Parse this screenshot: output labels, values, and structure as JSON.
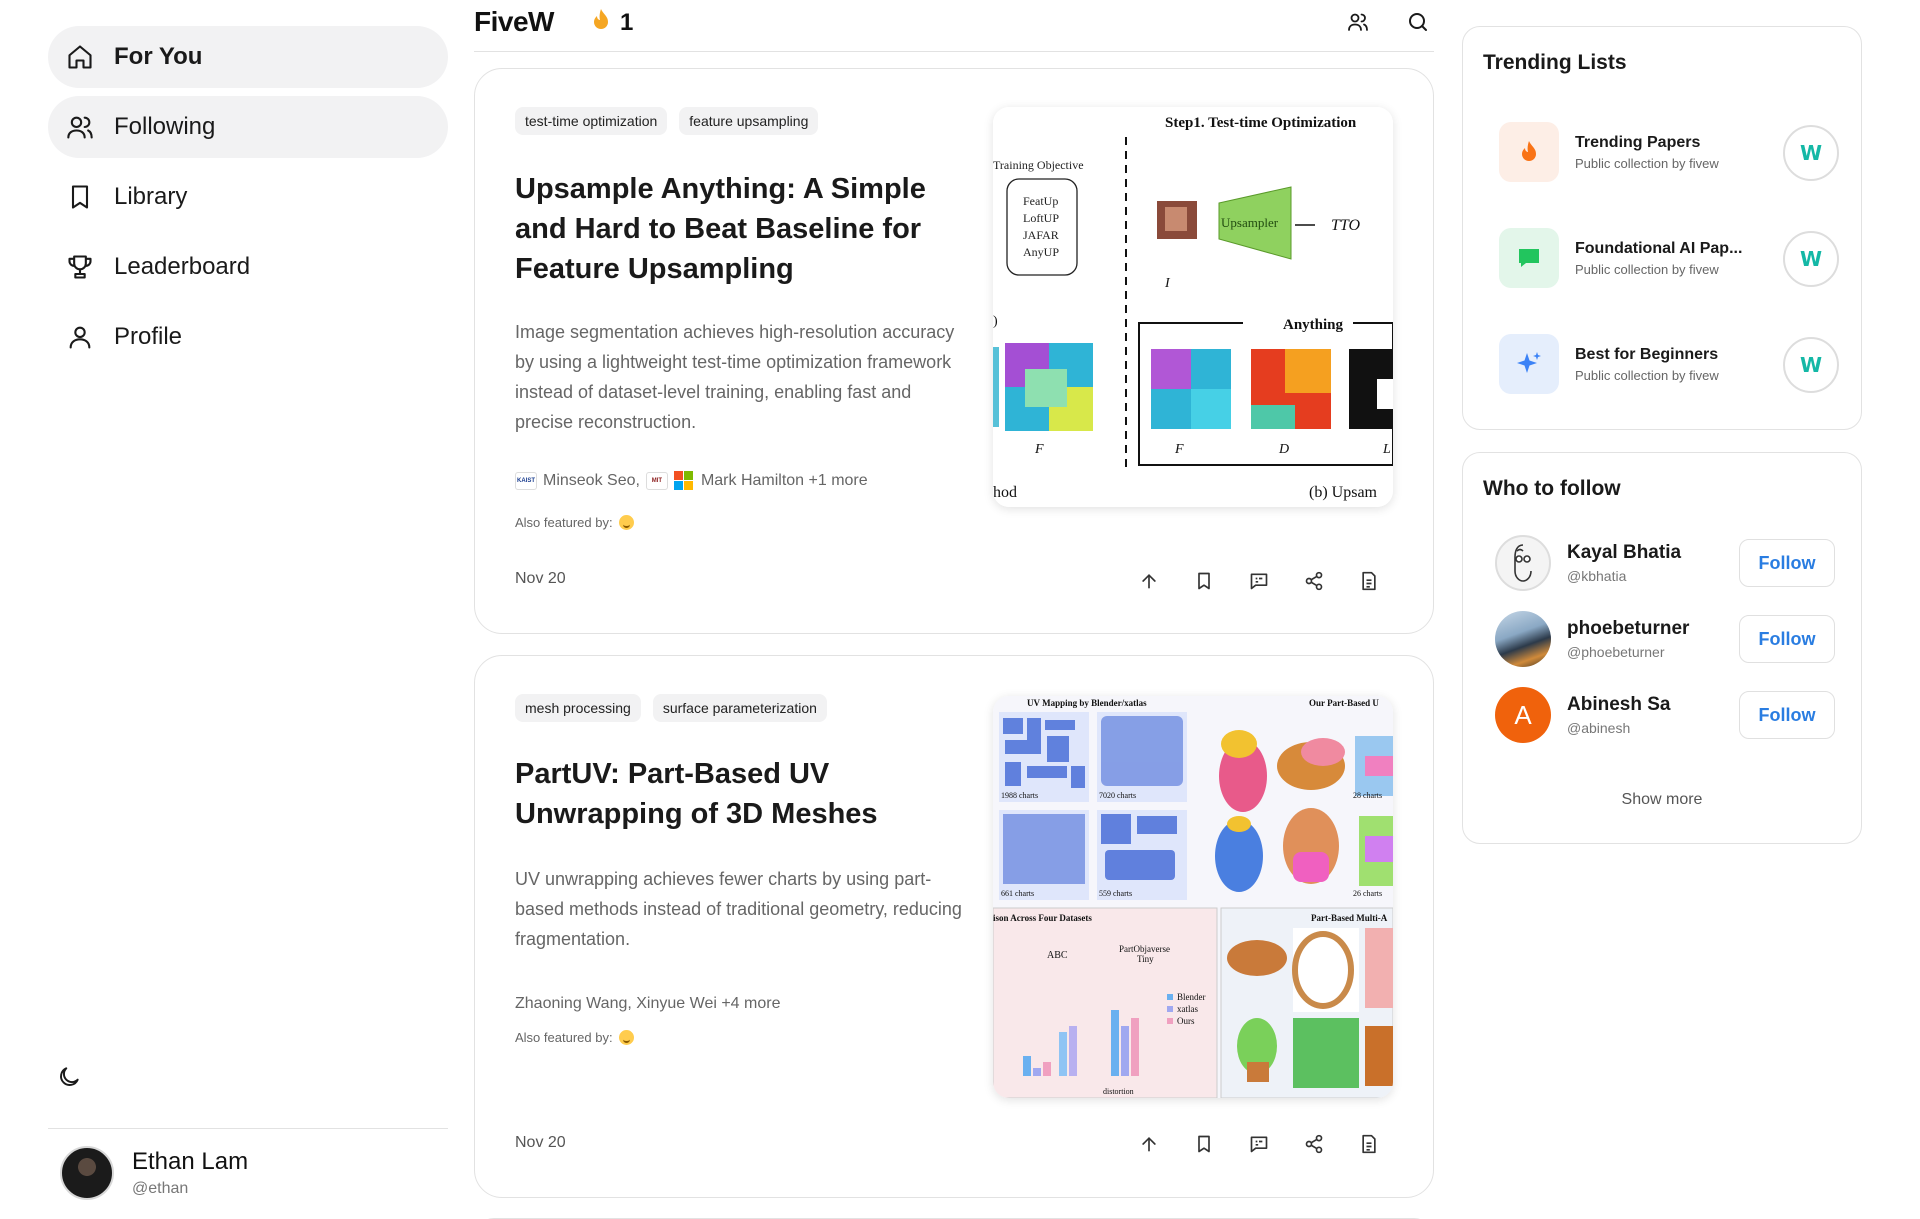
{
  "nav": {
    "items": [
      {
        "label": "For You",
        "icon": "home-icon"
      },
      {
        "label": "Following",
        "icon": "users-icon"
      },
      {
        "label": "Library",
        "icon": "bookmark-icon"
      },
      {
        "label": "Leaderboard",
        "icon": "trophy-icon"
      },
      {
        "label": "Profile",
        "icon": "user-icon"
      }
    ],
    "theme_icon": "moon-icon"
  },
  "user": {
    "name": "Ethan Lam",
    "handle": "@ethan"
  },
  "header": {
    "brand": "FiveW",
    "streak": "1",
    "streak_icon": "flame-icon"
  },
  "papers": [
    {
      "tags": [
        "test-time optimization",
        "feature upsampling"
      ],
      "title": "Upsample Anything: A Simple and Hard to Beat Baseline for Feature Upsampling",
      "summary": "Image segmentation achieves high-resolution accuracy by using a lightweight test-time optimization framework instead of dataset-level training, enabling fast and precise reconstruction.",
      "authors": "Minseok Seo,",
      "authors_2": "Mark Hamilton +1 more",
      "org_logo_1": "KAIST",
      "org_logo_2": "MIT",
      "featured_label": "Also featured by:",
      "date": "Nov 20",
      "figure": {
        "step_title": "Step1. Test-time Optimization",
        "objective_label": "Training Objective",
        "objectives": [
          "FeatUp",
          "LoftUP",
          "JAFAR",
          "AnyUP"
        ],
        "upsampler": "Upsampler",
        "tto": "TTO",
        "ilr": "I",
        "anything": "Anything",
        "fhr": "F",
        "flr": "F",
        "dlr": "D",
        "l": "L",
        "method": "hod",
        "caption": "(b) Upsam"
      }
    },
    {
      "tags": [
        "mesh processing",
        "surface parameterization"
      ],
      "title": "PartUV: Part-Based UV Unwrapping of 3D Meshes",
      "summary": "UV unwrapping achieves fewer charts by using part-based methods instead of traditional geometry, reducing fragmentation.",
      "authors": "Zhaoning Wang, Xinyue Wei +4 more",
      "featured_label": "Also featured by:",
      "date": "Nov 20",
      "figure": {
        "top_left": "UV Mapping by Blender/xatlas",
        "top_right": "Our Part-Based U",
        "counts": [
          "1988 charts",
          "7020 charts",
          "661 charts",
          "559 charts",
          "28 charts",
          "26 charts"
        ],
        "bottom_left": "ison Across Four Datasets",
        "abc": "ABC",
        "partobj": "PartObjaverse",
        "tiny": "Tiny",
        "legend": [
          "Blender",
          "xatlas",
          "Ours"
        ],
        "distortion": "distortion",
        "bottom_right": "Part-Based Multi-A"
      }
    }
  ],
  "trending": {
    "title": "Trending Lists",
    "lists": [
      {
        "name": "Trending Papers",
        "sub": "Public collection by fivew",
        "icon": "flame-icon",
        "color": "#f97316",
        "bg": "#fdeee6",
        "badge": "W"
      },
      {
        "name": "Foundational AI Pap...",
        "sub": "Public collection by fivew",
        "icon": "chat-bubble-icon",
        "color": "#22c55e",
        "bg": "#e3f6ea",
        "badge": "W"
      },
      {
        "name": "Best for Beginners",
        "sub": "Public collection by fivew",
        "icon": "sparkle-icon",
        "color": "#3b82f6",
        "bg": "#e5eefc",
        "badge": "W"
      }
    ]
  },
  "who_to_follow": {
    "title": "Who to follow",
    "people": [
      {
        "name": "Kayal Bhatia",
        "handle": "@kbhatia",
        "button": "Follow"
      },
      {
        "name": "phoebeturner",
        "handle": "@phoebeturner",
        "button": "Follow"
      },
      {
        "name": "Abinesh Sa",
        "handle": "@abinesh",
        "button": "Follow",
        "initial": "A"
      }
    ],
    "show_more": "Show more"
  },
  "colors": {
    "accent": "#2a7de1",
    "badge": "#14b8a6",
    "abinesh_avatar": "#f0620c"
  }
}
